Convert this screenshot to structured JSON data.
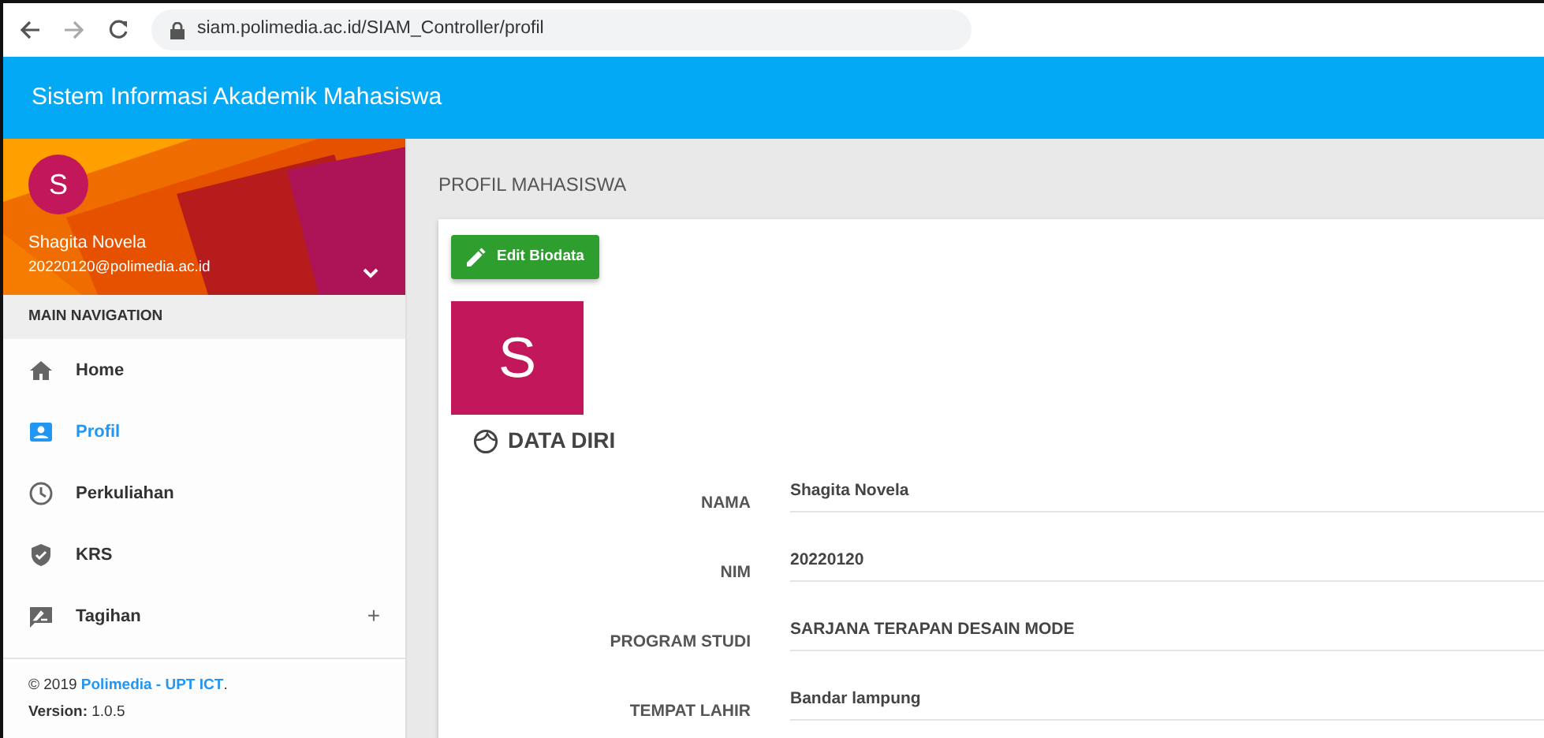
{
  "browser": {
    "url": "siam.polimedia.ac.id/SIAM_Controller/profil"
  },
  "header": {
    "title": "Sistem Informasi Akademik Mahasiswa"
  },
  "sidebar": {
    "user": {
      "initial": "S",
      "name": "Shagita Novela",
      "email": "20220120@polimedia.ac.id"
    },
    "section": "MAIN NAVIGATION",
    "items": [
      {
        "label": "Home",
        "selected": false
      },
      {
        "label": "Profil",
        "selected": true
      },
      {
        "label": "Perkuliahan",
        "selected": false
      },
      {
        "label": "KRS",
        "selected": false
      },
      {
        "label": "Tagihan",
        "selected": false,
        "toggle": "+"
      }
    ],
    "footer": {
      "prefix": "© 2019 ",
      "link": "Polimedia - UPT ICT",
      "suffix": ".",
      "version": "**Version:** 1.0.5"
    }
  },
  "content": {
    "title": "PROFIL MAHASISWA",
    "edit_button": "Edit Biodata",
    "avatar": "S",
    "section": "DATA DIRI",
    "fields": [
      {
        "label": "NAMA",
        "value": "Shagita Novela"
      },
      {
        "label": "NIM",
        "value": "20220120"
      },
      {
        "label": "PROGRAM STUDI",
        "value": "SARJANA TERAPAN DESAIN MODE"
      },
      {
        "label": "TEMPAT LAHIR",
        "value": "Bandar lampung"
      }
    ]
  }
}
